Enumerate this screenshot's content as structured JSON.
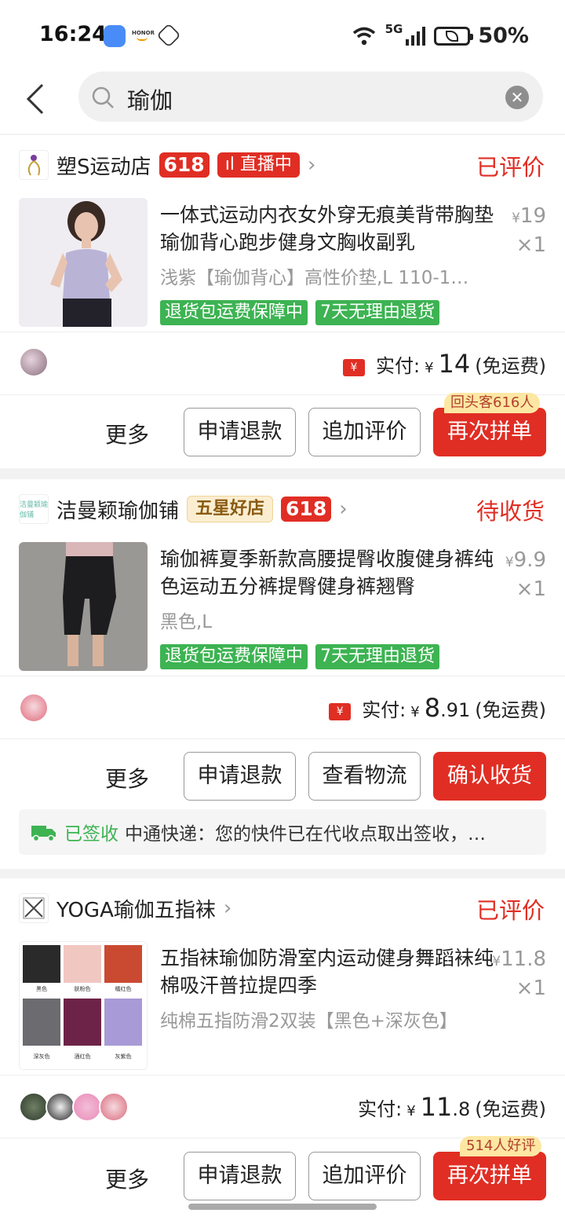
{
  "status_bar": {
    "time": "16:24",
    "honor_label": "HONOR",
    "network": "5G",
    "wifi_label": "6",
    "battery": "50%"
  },
  "search": {
    "query": "瑜伽"
  },
  "orders": [
    {
      "shop_name": "塑S运动店",
      "badge_618": "618",
      "badge_live": "直播中",
      "status": "已评价",
      "title": "一体式运动内衣女外穿无痕美背带胸垫瑜伽背心跑步健身文胸收副乳",
      "spec": "浅紫【瑜伽背心】高性价垫,L 110-1…",
      "price_symbol": "¥",
      "price": "19",
      "qty": "×1",
      "tags": [
        "退货包运费保障中",
        "7天无理由退货"
      ],
      "paid_label": "实付:",
      "paid_symbol": "¥",
      "paid_amount": "14",
      "shipping": "(免运费)",
      "buttons": {
        "more": "更多",
        "refund": "申请退款",
        "review": "追加评价",
        "rebuy": "再次拼单"
      },
      "hint": "回头客616人"
    },
    {
      "shop_name": "洁曼颖瑜伽铺",
      "shop_logo_text": "洁曼颖瑜伽铺",
      "badge_star": "五星好店",
      "badge_618": "618",
      "status": "待收货",
      "title": "瑜伽裤夏季新款高腰提臀收腹健身裤纯色运动五分裤提臀健身裤翘臀",
      "spec": "黑色,L",
      "price_symbol": "¥",
      "price": "9.9",
      "qty": "×1",
      "tags": [
        "退货包运费保障中",
        "7天无理由退货"
      ],
      "paid_label": "实付:",
      "paid_symbol": "¥",
      "paid_amount_int": "8",
      "paid_amount_dec": ".91",
      "shipping": "(免运费)",
      "buttons": {
        "more": "更多",
        "refund": "申请退款",
        "logistics": "查看物流",
        "confirm": "确认收货"
      },
      "logistics": {
        "state": "已签收",
        "text": "中通快递：您的快件已在代收点取出签收，…"
      }
    },
    {
      "shop_name": "YOGA瑜伽五指袜",
      "status": "已评价",
      "title": "五指袜瑜伽防滑室内运动健身舞蹈袜纯棉吸汗普拉提四季",
      "spec": "纯棉五指防滑2双装【黑色+深灰色】",
      "price_symbol": "¥",
      "price": "11.8",
      "qty": "×1",
      "sock_colors": [
        "黑色",
        "肤粉色",
        "橘红色",
        "深灰色",
        "酒红色",
        "灰紫色"
      ],
      "paid_label": "实付:",
      "paid_symbol": "¥",
      "paid_amount_int": "11",
      "paid_amount_dec": ".8",
      "shipping": "(免运费)",
      "buttons": {
        "more": "更多",
        "refund": "申请退款",
        "review": "追加评价",
        "rebuy": "再次拼单"
      },
      "hint": "514人好评"
    }
  ],
  "colors": {
    "accent_red": "#e02e24",
    "tag_green": "#3db352",
    "hint_yellow": "#fde7a3"
  }
}
